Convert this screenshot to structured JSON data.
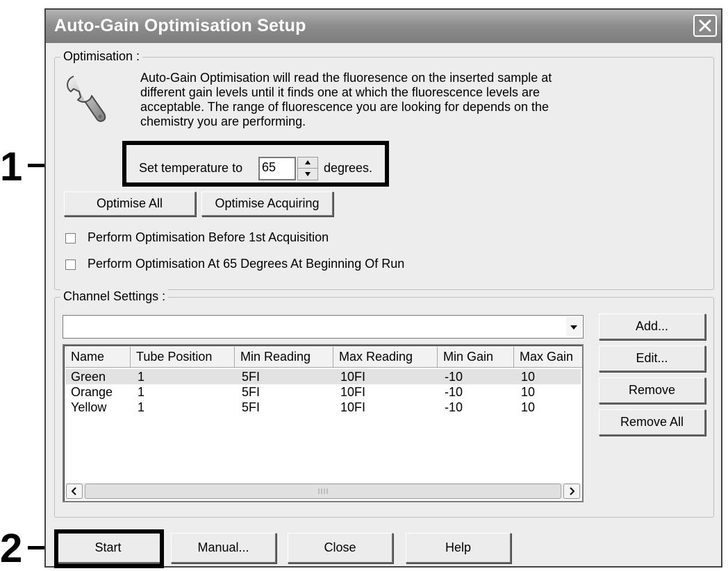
{
  "callouts": [
    "1",
    "2"
  ],
  "window": {
    "title": "Auto-Gain Optimisation Setup",
    "close_icon": "close-x-icon"
  },
  "optimisation": {
    "group_label": "Optimisation :",
    "icon": "wrench-icon",
    "description_lines": [
      "Auto-Gain Optimisation will read the fluoresence on the inserted sample at",
      "different gain levels until it finds one at which the fluorescence levels are",
      "acceptable. The range of fluorescence you are looking for depends on the",
      "chemistry you are performing."
    ],
    "temperature_prefix": "Set temperature to",
    "temperature_value": "65",
    "temperature_suffix": "degrees.",
    "optimise_all_label": "Optimise All",
    "optimise_acquiring_label": "Optimise Acquiring",
    "checkboxes": [
      {
        "label": "Perform Optimisation Before 1st Acquisition",
        "checked": false
      },
      {
        "label": "Perform Optimisation At 65 Degrees At Beginning Of Run",
        "checked": false
      }
    ]
  },
  "channel_settings": {
    "group_label": "Channel Settings :",
    "combo_value": "",
    "columns": [
      "Name",
      "Tube Position",
      "Min Reading",
      "Max Reading",
      "Min Gain",
      "Max Gain"
    ],
    "rows": [
      [
        "Green",
        "1",
        "5FI",
        "10FI",
        "-10",
        "10"
      ],
      [
        "Orange",
        "1",
        "5FI",
        "10FI",
        "-10",
        "10"
      ],
      [
        "Yellow",
        "1",
        "5FI",
        "10FI",
        "-10",
        "10"
      ]
    ],
    "selected_row": 0,
    "add_label": "Add...",
    "edit_label": "Edit...",
    "remove_label": "Remove",
    "remove_all_label": "Remove All"
  },
  "footer": {
    "start_label": "Start",
    "manual_label": "Manual...",
    "close_label": "Close",
    "help_label": "Help"
  },
  "colors": {
    "titlebar": "#8e8e8e",
    "window_bg": "#ededed",
    "callout": "#000000"
  }
}
